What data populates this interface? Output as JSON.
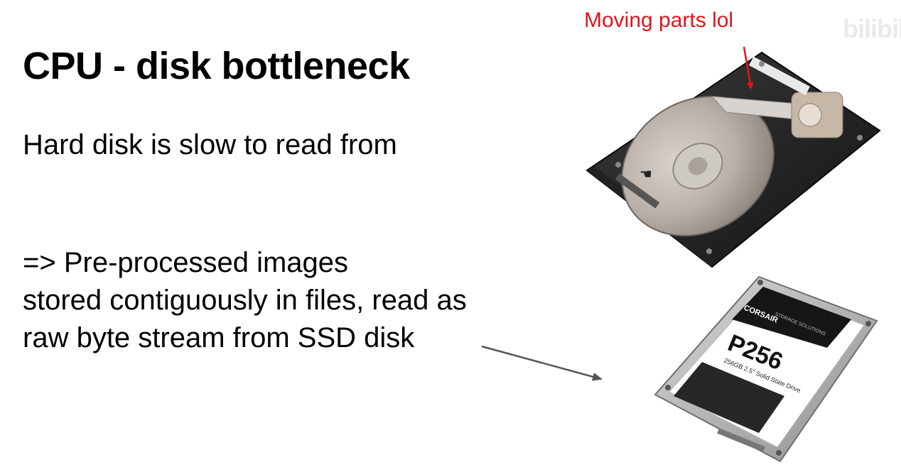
{
  "slide": {
    "title": "CPU - disk bottleneck",
    "bullet_1": "Hard disk is slow to read from",
    "bullet_2_lines": [
      "=> Pre-processed images",
      "stored contiguously in files, read as",
      "raw byte stream from SSD disk"
    ]
  },
  "annotation": {
    "text": "Moving parts lol",
    "color": "#e3131b"
  },
  "watermark": {
    "text": "bilibili"
  },
  "images": {
    "hdd": {
      "icon": "hard-disk-drive-icon"
    },
    "ssd": {
      "icon": "solid-state-drive-icon",
      "brand": "CORSAIR",
      "tagline": "STORAGE SOLUTIONS",
      "model": "P256",
      "subtitle": "256GB 2.5\" Solid State Drive"
    }
  }
}
